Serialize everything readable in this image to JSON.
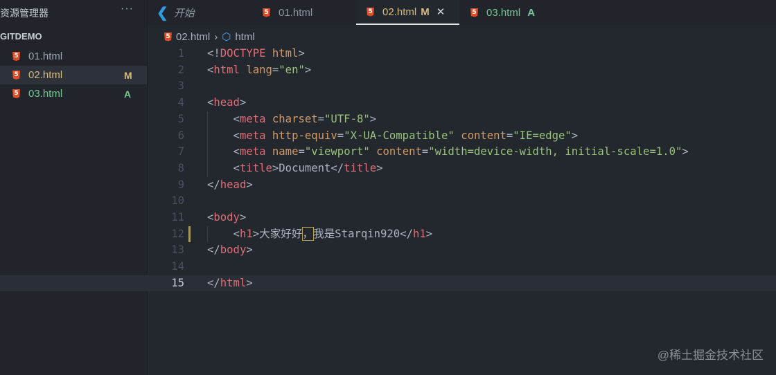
{
  "sidebar": {
    "title": "资源管理器",
    "more": "···",
    "project": "GITDEMO",
    "files": [
      {
        "name": "01.html",
        "badge": "",
        "color": "#9da5b4"
      },
      {
        "name": "02.html",
        "badge": "M",
        "color": "#d7ba7d"
      },
      {
        "name": "03.html",
        "badge": "A",
        "color": "#73c991"
      }
    ]
  },
  "tabs": [
    {
      "label": "开始",
      "icon": "vscode-icon"
    },
    {
      "label": "01.html",
      "badge": ""
    },
    {
      "label": "02.html",
      "badge": "M",
      "close": "✕"
    },
    {
      "label": "03.html",
      "badge": "A"
    }
  ],
  "breadcrumb": {
    "file": "02.html",
    "sep": "›",
    "symbol": "html"
  },
  "code": [
    [
      [
        "<!",
        "p"
      ],
      [
        "DOCTYPE",
        "t"
      ],
      [
        " ",
        "x"
      ],
      [
        "html",
        "a"
      ],
      [
        ">",
        "p"
      ]
    ],
    [
      [
        "<",
        "p"
      ],
      [
        "html",
        "t"
      ],
      [
        " ",
        "x"
      ],
      [
        "lang",
        "a"
      ],
      [
        "=",
        "p"
      ],
      [
        "\"en\"",
        "s"
      ],
      [
        ">",
        "p"
      ]
    ],
    [],
    [
      [
        "<",
        "p"
      ],
      [
        "head",
        "t"
      ],
      [
        ">",
        "p"
      ]
    ],
    [
      [
        "    <",
        "p"
      ],
      [
        "meta",
        "t"
      ],
      [
        " ",
        "x"
      ],
      [
        "charset",
        "a"
      ],
      [
        "=",
        "p"
      ],
      [
        "\"UTF-8\"",
        "s"
      ],
      [
        ">",
        "p"
      ]
    ],
    [
      [
        "    <",
        "p"
      ],
      [
        "meta",
        "t"
      ],
      [
        " ",
        "x"
      ],
      [
        "http-equiv",
        "a"
      ],
      [
        "=",
        "p"
      ],
      [
        "\"X-UA-Compatible\"",
        "s"
      ],
      [
        " ",
        "x"
      ],
      [
        "content",
        "a"
      ],
      [
        "=",
        "p"
      ],
      [
        "\"IE=edge\"",
        "s"
      ],
      [
        ">",
        "p"
      ]
    ],
    [
      [
        "    <",
        "p"
      ],
      [
        "meta",
        "t"
      ],
      [
        " ",
        "x"
      ],
      [
        "name",
        "a"
      ],
      [
        "=",
        "p"
      ],
      [
        "\"viewport\"",
        "s"
      ],
      [
        " ",
        "x"
      ],
      [
        "content",
        "a"
      ],
      [
        "=",
        "p"
      ],
      [
        "\"width=device-width, initial-scale=1.0\"",
        "s"
      ],
      [
        ">",
        "p"
      ]
    ],
    [
      [
        "    <",
        "p"
      ],
      [
        "title",
        "t"
      ],
      [
        ">Document</",
        "p"
      ],
      [
        "title",
        "t"
      ],
      [
        ">",
        "p"
      ]
    ],
    [
      [
        "</",
        "p"
      ],
      [
        "head",
        "t"
      ],
      [
        ">",
        "p"
      ]
    ],
    [],
    [
      [
        "<",
        "p"
      ],
      [
        "body",
        "t"
      ],
      [
        ">",
        "p"
      ]
    ],
    [
      [
        "    <",
        "p"
      ],
      [
        "h1",
        "t"
      ],
      [
        ">大家好好",
        "p"
      ],
      [
        "，",
        "m"
      ],
      [
        "我是Starqin920</",
        "p"
      ],
      [
        "h1",
        "t"
      ],
      [
        ">",
        "p"
      ]
    ],
    [
      [
        "</",
        "p"
      ],
      [
        "body",
        "t"
      ],
      [
        ">",
        "p"
      ]
    ],
    [],
    [
      [
        "</",
        "p"
      ],
      [
        "html",
        "t"
      ],
      [
        ">",
        "p"
      ]
    ]
  ],
  "watermark": "@稀土掘金技术社区"
}
